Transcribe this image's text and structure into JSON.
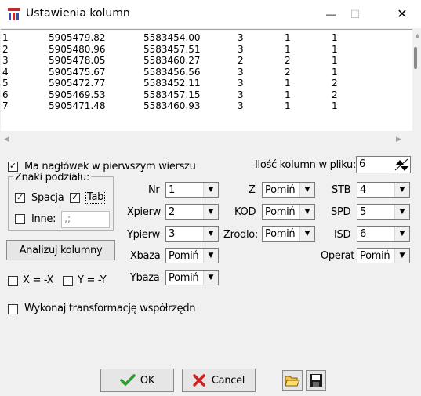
{
  "window": {
    "title": "Ustawienia kolumn",
    "minimize_glyph": "—",
    "maximize_glyph": "☐",
    "close_glyph": "✕"
  },
  "table": {
    "rows": [
      [
        "1",
        "5905479.82",
        "5583454.00",
        "3",
        "1",
        "1"
      ],
      [
        "2",
        "5905480.96",
        "5583457.51",
        "3",
        "1",
        "1"
      ],
      [
        "3",
        "5905478.05",
        "5583460.27",
        "2",
        "2",
        "1"
      ],
      [
        "4",
        "5905475.67",
        "5583456.56",
        "3",
        "2",
        "1"
      ],
      [
        "5",
        "5905472.77",
        "5583452.11",
        "3",
        "1",
        "2"
      ],
      [
        "6",
        "5905469.53",
        "5583457.15",
        "3",
        "1",
        "2"
      ],
      [
        "7",
        "5905471.48",
        "5583460.93",
        "3",
        "1",
        "1"
      ]
    ]
  },
  "options": {
    "header_checkbox_label": "Ma nagłówek w pierwszym wierszu",
    "header_checked": true,
    "column_count_label": "Ilość kolumn w pliku:",
    "column_count_value": "6",
    "delimiters_title": "Znaki podziału:",
    "space_label": "Spacja",
    "space_checked": true,
    "tab_label": "Tab",
    "tab_checked": true,
    "other_label": "Inne:",
    "other_checked": false,
    "other_value": ",;",
    "analyze_button": "Analizuj kolumny",
    "x_flip_label": "X = -X",
    "y_flip_label": "Y = -Y",
    "transform_label": "Wykonaj transformację współrzędn"
  },
  "fields": {
    "nr": {
      "label": "Nr",
      "value": "1"
    },
    "xpierw": {
      "label": "Xpierw",
      "value": "2"
    },
    "ypierw": {
      "label": "Ypierw",
      "value": "3"
    },
    "xbaza": {
      "label": "Xbaza",
      "value": "Pomiń"
    },
    "ybaza": {
      "label": "Ybaza",
      "value": "Pomiń"
    },
    "z": {
      "label": "Z",
      "value": "Pomiń"
    },
    "kod": {
      "label": "KOD",
      "value": "Pomiń"
    },
    "zrodlo": {
      "label": "Zrodlo:",
      "value": "Pomiń"
    },
    "stb": {
      "label": "STB",
      "value": "4"
    },
    "spd": {
      "label": "SPD",
      "value": "5"
    },
    "isd": {
      "label": "ISD",
      "value": "6"
    },
    "operat": {
      "label": "Operat",
      "value": "Pomiń"
    }
  },
  "buttons": {
    "ok": "OK",
    "cancel": "Cancel"
  },
  "colors": {
    "ok_check": "#2a9d2a",
    "cancel_x": "#d42020",
    "app_icon": "#c0282f"
  }
}
